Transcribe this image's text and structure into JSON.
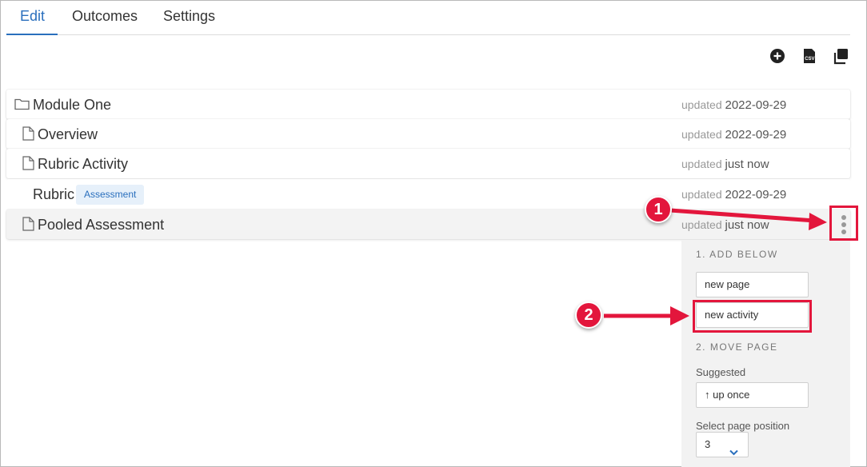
{
  "tabs": [
    {
      "label": "Edit",
      "active": true
    },
    {
      "label": "Outcomes",
      "active": false
    },
    {
      "label": "Settings",
      "active": false
    }
  ],
  "toolbar": {
    "add_icon": "plus-circle-icon",
    "csv_icon": "csv-file-icon",
    "copy_icon": "copy-icon"
  },
  "rows": [
    {
      "title": "Module One",
      "icon": "folder-icon",
      "updated_label": "updated",
      "updated_value": "2022-09-29"
    },
    {
      "title": "Overview",
      "icon": "page-icon",
      "updated_label": "updated",
      "updated_value": "2022-09-29"
    },
    {
      "title": "Rubric Activity",
      "icon": "page-icon",
      "updated_label": "updated",
      "updated_value": "just now"
    },
    {
      "title": "Rubric",
      "badge": "Assessment",
      "updated_label": "updated",
      "updated_value": "2022-09-29"
    },
    {
      "title": "Pooled Assessment",
      "icon": "page-icon",
      "updated_label": "updated",
      "updated_value": "just now"
    }
  ],
  "callouts": {
    "one": "1",
    "two": "2"
  },
  "menu": {
    "add_heading": "1. ADD BELOW",
    "new_page": "new page",
    "new_activity": "new activity",
    "move_heading": "2. MOVE PAGE",
    "suggested_label": "Suggested",
    "suggested_button": "↑ up once",
    "position_label": "Select page position",
    "position_value": "3"
  },
  "colors": {
    "accent": "#2a6fbd",
    "callout": "#e3163c"
  }
}
